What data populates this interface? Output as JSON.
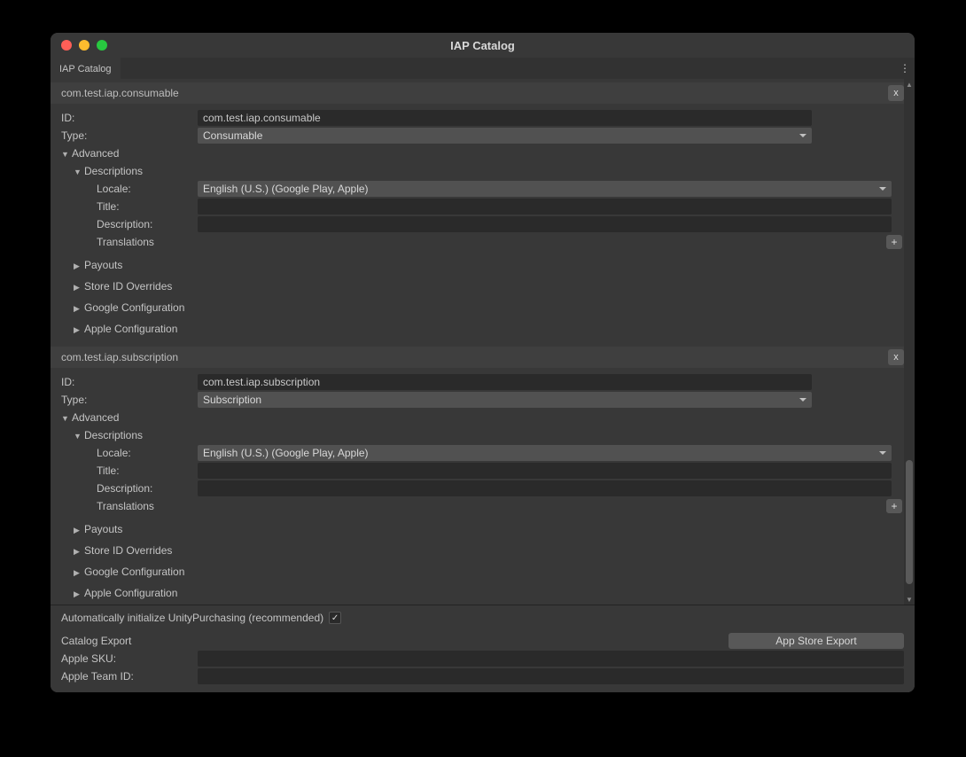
{
  "window": {
    "title": "IAP Catalog",
    "tab": "IAP Catalog"
  },
  "labels": {
    "id": "ID:",
    "type": "Type:",
    "advanced": "Advanced",
    "descriptions": "Descriptions",
    "locale": "Locale:",
    "title": "Title:",
    "description": "Description:",
    "translations": "Translations",
    "payouts": "Payouts",
    "storeIdOverrides": "Store ID Overrides",
    "googleConfig": "Google Configuration",
    "appleConfig": "Apple Configuration"
  },
  "products": [
    {
      "headerName": "com.test.iap.consumable",
      "id": "com.test.iap.consumable",
      "type": "Consumable",
      "locale": "English (U.S.) (Google Play, Apple)",
      "titleValue": "",
      "descriptionValue": ""
    },
    {
      "headerName": "com.test.iap.subscription",
      "id": "com.test.iap.subscription",
      "type": "Subscription",
      "locale": "English (U.S.) (Google Play, Apple)",
      "titleValue": "",
      "descriptionValue": ""
    }
  ],
  "bottom": {
    "autoInitLabel": "Automatically initialize UnityPurchasing (recommended)",
    "autoInitChecked": "✓",
    "catalogExport": "Catalog Export",
    "appStoreExport": "App Store Export",
    "appleSkuLabel": "Apple SKU:",
    "appleSkuValue": "",
    "appleTeamIdLabel": "Apple Team ID:",
    "appleTeamIdValue": ""
  },
  "buttons": {
    "remove": "x",
    "add": "+"
  }
}
